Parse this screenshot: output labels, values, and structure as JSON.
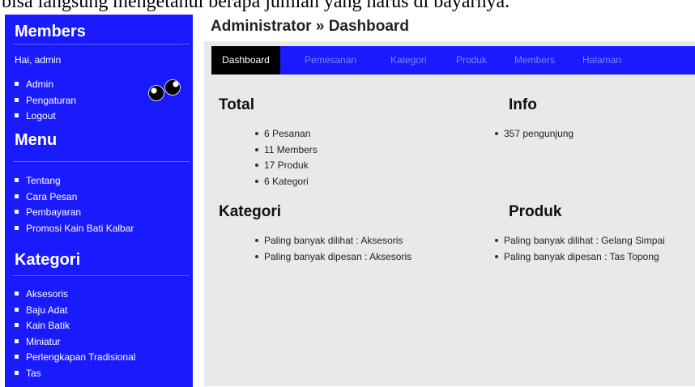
{
  "top_caption": "bisa langsung mengetahui berapa jumlah yang harus di bayarnya.",
  "sidebar": {
    "members_heading": "Members",
    "greeting": "Hai, admin",
    "members_items": [
      {
        "label": "Admin"
      },
      {
        "label": "Pengaturan"
      },
      {
        "label": "Logout"
      }
    ],
    "menu_heading": "Menu",
    "menu_items": [
      {
        "label": "Tentang"
      },
      {
        "label": "Cara Pesan"
      },
      {
        "label": "Pembayaran"
      },
      {
        "label": "Promosi Kain Bati Kalbar"
      }
    ],
    "kategori_heading": "Kategori",
    "kategori_items": [
      {
        "label": "Aksesoris"
      },
      {
        "label": "Baju Adat"
      },
      {
        "label": "Kain Batik"
      },
      {
        "label": "Miniatur"
      },
      {
        "label": "Perlengkapan Tradisional"
      },
      {
        "label": "Tas"
      }
    ]
  },
  "header": {
    "title": "Administrator » Dashboard"
  },
  "nav": {
    "tabs": [
      {
        "label": "Dashboard"
      },
      {
        "label": "Pemesanan"
      },
      {
        "label": "Kategori"
      },
      {
        "label": "Produk"
      },
      {
        "label": "Members"
      },
      {
        "label": "Halaman"
      }
    ],
    "active": "Dashboard"
  },
  "sections": {
    "total": {
      "title": "Total",
      "items": [
        "6 Pesanan",
        "11 Members",
        "17 Produk",
        "6 Kategori"
      ]
    },
    "info": {
      "title": "Info",
      "items": [
        "357 pengunjung"
      ]
    },
    "kategori": {
      "title": "Kategori",
      "items": [
        "Paling banyak dilihat : Aksesoris",
        "Paling banyak dipesan : Aksesoris"
      ]
    },
    "produk": {
      "title": "Produk",
      "items": [
        "Paling banyak dilihat : Gelang Simpai",
        "Paling banyak dipesan : Tas Topong"
      ]
    }
  },
  "colors": {
    "sidebar_bg": "#1a1aff",
    "nav_bg": "#1a1aff",
    "nav_active_bg": "#000000",
    "nav_inactive_text": "#7d86ff",
    "content_bg": "#e9e9e9"
  },
  "icons": {
    "eyes": "googly-eyes-icon"
  }
}
